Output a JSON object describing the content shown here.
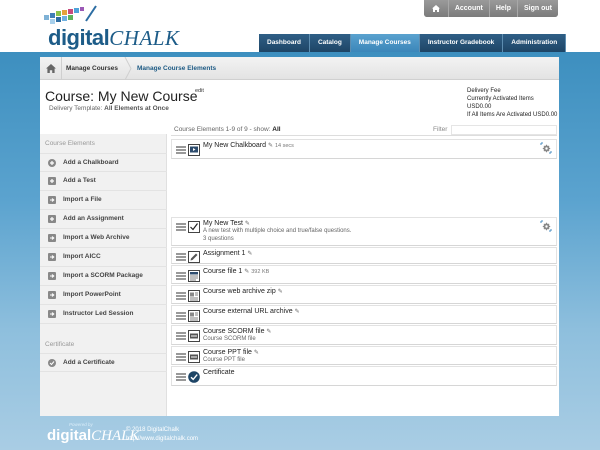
{
  "header": {
    "logo": {
      "prefix": "digital",
      "suffix": "CHALK"
    },
    "util": {
      "home_icon": "home-icon",
      "account": "Account",
      "help": "Help",
      "signout": "Sign out"
    },
    "nav": [
      {
        "label": "Dashboard"
      },
      {
        "label": "Catalog"
      },
      {
        "label": "Manage Courses",
        "active": true
      },
      {
        "label": "Instructor Gradebook"
      },
      {
        "label": "Administration"
      }
    ]
  },
  "breadcrumb": {
    "home_icon": "home-icon",
    "items": [
      "Manage Courses",
      "Manage Course Elements"
    ]
  },
  "course": {
    "title": "Course: My New Course",
    "edit_label": "edit",
    "template_label": "Delivery Template:",
    "template_value": "All Elements at Once"
  },
  "fees": {
    "line1": "Delivery Fee",
    "line2": "Currently Activated Items USD0.00",
    "line3": "If All Items Are Activated USD0.00"
  },
  "sidebar": {
    "section1": "Course Elements",
    "items": [
      {
        "label": "Add a Chalkboard",
        "icon": "plus-circle-icon"
      },
      {
        "label": "Add a Test",
        "icon": "plus-square-icon"
      },
      {
        "label": "Import a File",
        "icon": "import-icon"
      },
      {
        "label": "Add an Assignment",
        "icon": "plus-square-icon"
      },
      {
        "label": "Import a Web Archive",
        "icon": "import-icon"
      },
      {
        "label": "Import AICC",
        "icon": "import-icon"
      },
      {
        "label": "Import a SCORM Package",
        "icon": "import-icon"
      },
      {
        "label": "Import PowerPoint",
        "icon": "import-icon"
      },
      {
        "label": "Instructor Led Session",
        "icon": "import-icon"
      }
    ],
    "section2": "Certificate",
    "cert_item": {
      "label": "Add a Certificate",
      "icon": "check-circle-icon"
    }
  },
  "list": {
    "summary_prefix": "Course Elements 1-9 of 9 - show:",
    "summary_show": "All",
    "filter_label": "Filter",
    "rows": [
      {
        "name": "My New Chalkboard",
        "meta": "14 secs",
        "icon": "chalkboard-icon",
        "sub": [],
        "gear": true
      },
      {
        "name": "My New Test",
        "meta": "",
        "icon": "test-checkbox-icon",
        "sub": [
          "A new test with multiple choice and true/false questions.",
          "3 questions"
        ],
        "gear": true
      },
      {
        "name": "Assignment 1",
        "meta": "",
        "icon": "assignment-pencil-icon",
        "sub": [],
        "gear": false
      },
      {
        "name": "Course file 1",
        "meta": "392 KB",
        "icon": "file-icon",
        "sub": [],
        "gear": false
      },
      {
        "name": "Course web archive zip",
        "meta": "",
        "icon": "web-archive-icon",
        "sub": [],
        "gear": false
      },
      {
        "name": "Course external URL archive",
        "meta": "",
        "icon": "web-archive-icon",
        "sub": [],
        "gear": false
      },
      {
        "name": "Course SCORM file",
        "meta": "",
        "icon": "scorm-icon",
        "sub": [
          "Course SCORM file"
        ],
        "gear": false
      },
      {
        "name": "Course PPT file",
        "meta": "",
        "icon": "ppt-icon",
        "sub": [
          "Course PPT file"
        ],
        "gear": false
      },
      {
        "name": "Certificate",
        "meta": "",
        "icon": "certificate-check-icon",
        "sub": [],
        "gear": false
      }
    ]
  },
  "footer": {
    "powered_by": "Powered by",
    "logo_prefix": "digital",
    "logo_suffix": "CHALK",
    "copyright": "© 2018 DigitalChalk",
    "url": "http://www.digitalchalk.com"
  }
}
